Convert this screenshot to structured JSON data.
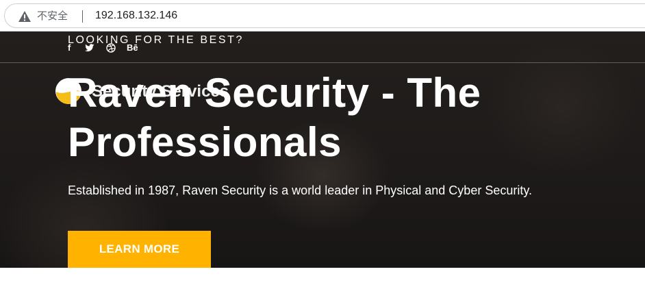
{
  "browser": {
    "security_label": "不安全",
    "url": "192.168.132.146",
    "icons": {
      "warning": "warning-triangle-icon"
    }
  },
  "topbar": {
    "tagline": "LOOKING FOR THE BEST?",
    "social": [
      {
        "name": "facebook-icon",
        "glyph": "f"
      },
      {
        "name": "twitter-icon",
        "glyph": "t"
      },
      {
        "name": "dribbble-icon",
        "glyph": "⊛"
      },
      {
        "name": "behance-icon",
        "glyph": "Bē"
      }
    ]
  },
  "brand": {
    "logo_icon": "logo-icon",
    "name": "Security Services"
  },
  "hero": {
    "headline": "Raven Security - The Professionals",
    "subtext": "Established in 1987, Raven Security is a world leader in Physical and Cyber Security.",
    "cta_label": "LEARN MORE"
  },
  "colors": {
    "accent": "#ffb300",
    "hero_bg": "#1d1a19",
    "text_on_dark": "#ffffff"
  }
}
